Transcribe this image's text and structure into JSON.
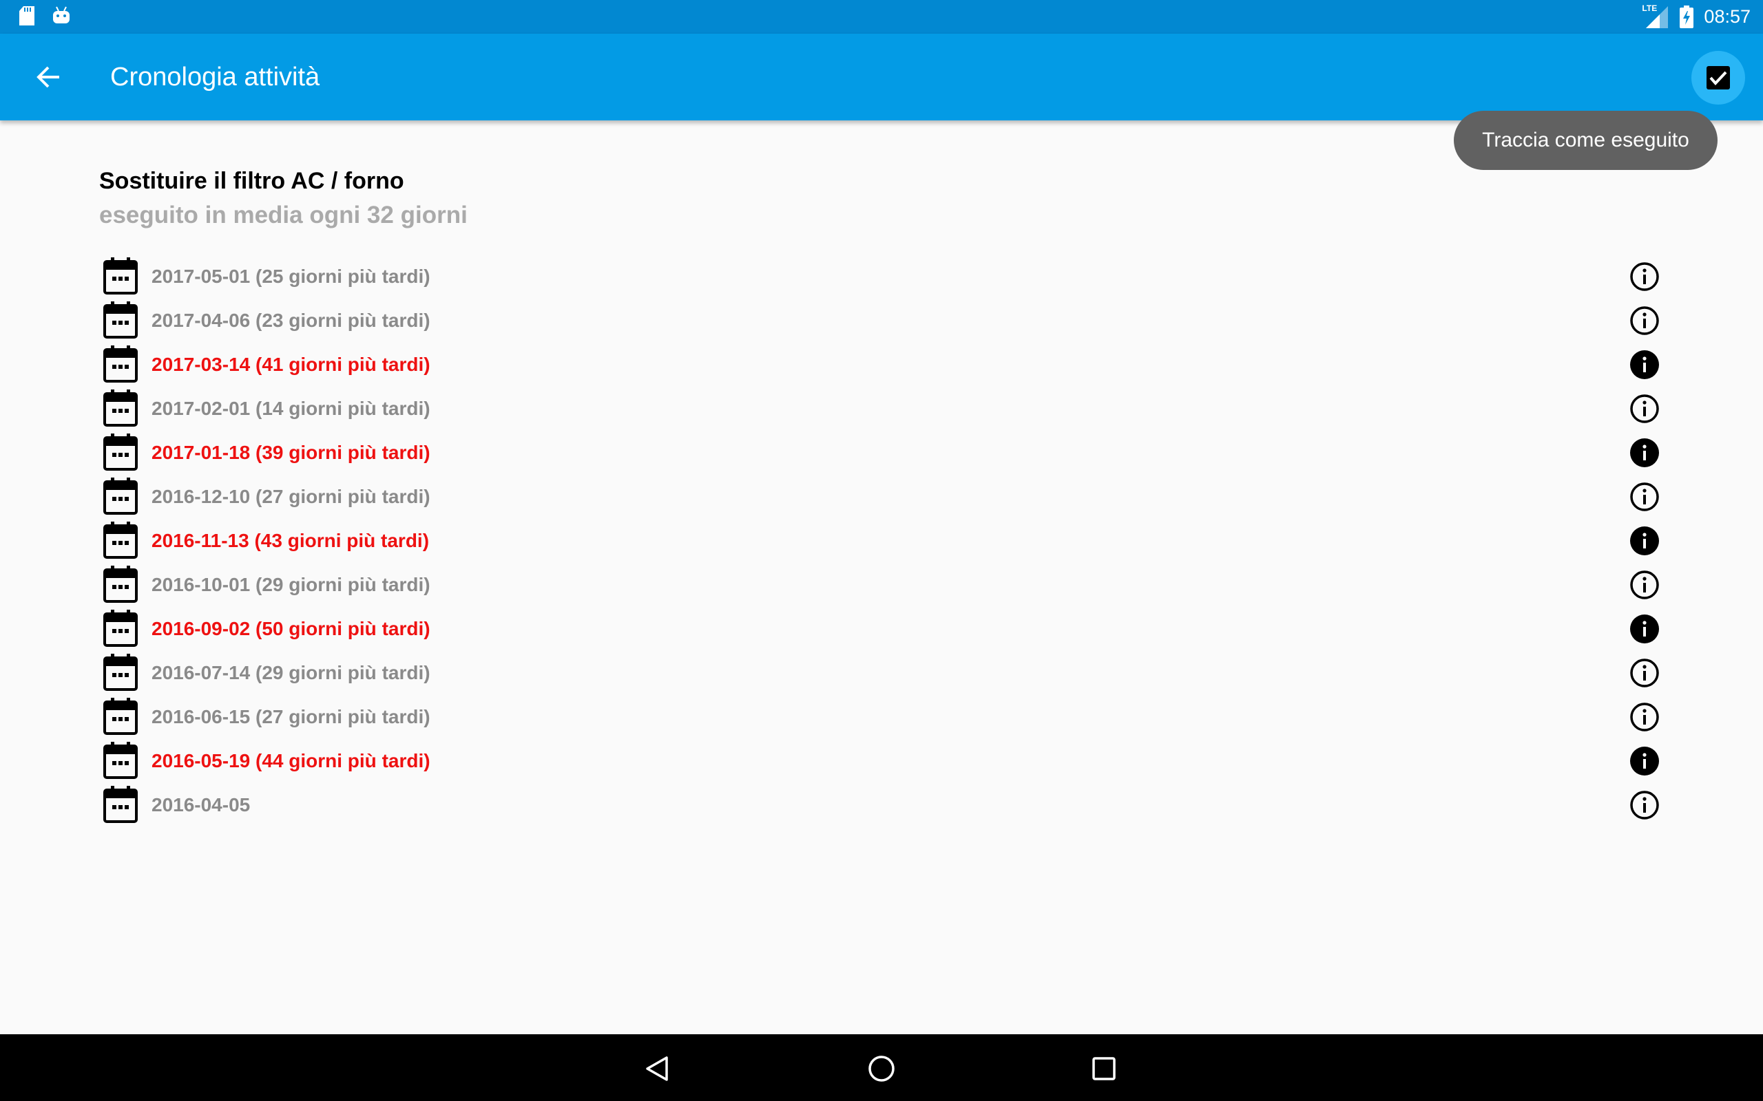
{
  "status_bar": {
    "time": "08:57",
    "network_label": "LTE",
    "icons": [
      "sd-card-icon",
      "android-icon",
      "lte-signal-icon",
      "battery-charging-icon"
    ]
  },
  "app_bar": {
    "title": "Cronologia attività",
    "background_color": "#039be5",
    "status_color": "#0288d1"
  },
  "tooltip": {
    "text": "Traccia come eseguito"
  },
  "task": {
    "title": "Sostituire il filtro AC / forno",
    "subtitle": "eseguito in media ogni 32 giorni"
  },
  "history": [
    {
      "label": "2017-05-01 (25 giorni più tardi)",
      "late": false
    },
    {
      "label": "2017-04-06 (23 giorni più tardi)",
      "late": false
    },
    {
      "label": "2017-03-14 (41 giorni più tardi)",
      "late": true
    },
    {
      "label": "2017-02-01 (14 giorni più tardi)",
      "late": false
    },
    {
      "label": "2017-01-18 (39 giorni più tardi)",
      "late": true
    },
    {
      "label": "2016-12-10 (27 giorni più tardi)",
      "late": false
    },
    {
      "label": "2016-11-13 (43 giorni più tardi)",
      "late": true
    },
    {
      "label": "2016-10-01 (29 giorni più tardi)",
      "late": false
    },
    {
      "label": "2016-09-02 (50 giorni più tardi)",
      "late": true
    },
    {
      "label": "2016-07-14 (29 giorni più tardi)",
      "late": false
    },
    {
      "label": "2016-06-15 (27 giorni più tardi)",
      "late": false
    },
    {
      "label": "2016-05-19 (44 giorni più tardi)",
      "late": true
    },
    {
      "label": "2016-04-05",
      "late": false
    }
  ],
  "colors": {
    "late_text": "#ee1111",
    "normal_text": "#8a8a8a",
    "subtitle_text": "#aaaaaa",
    "tooltip_bg": "#616161"
  },
  "nav_bar": {
    "buttons": [
      "back-triangle-icon",
      "home-circle-icon",
      "recents-square-icon"
    ]
  }
}
